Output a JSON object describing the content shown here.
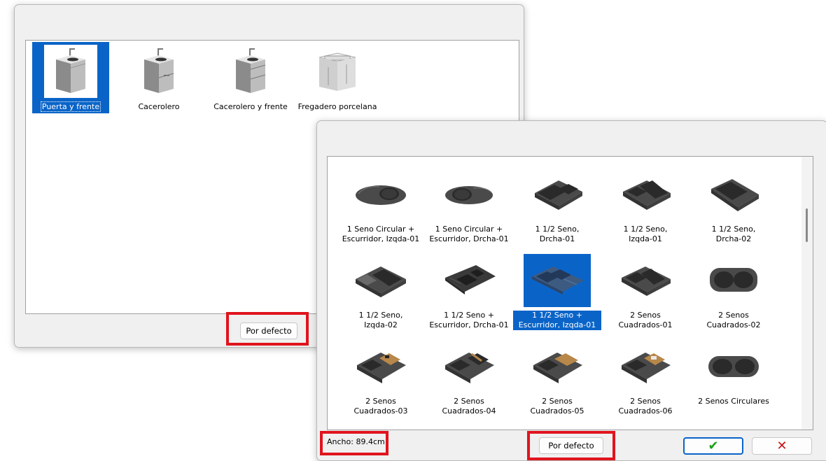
{
  "dialog1": {
    "items": [
      {
        "label": "Puerta y frente",
        "icon": "sink-cabinet-door-icon",
        "selected": true
      },
      {
        "label": "Cacerolero",
        "icon": "sink-cabinet-drawer-icon",
        "selected": false
      },
      {
        "label": "Cacerolero y frente",
        "icon": "sink-cabinet-drawer-front-icon",
        "selected": false
      },
      {
        "label": "Fregadero porcelana",
        "icon": "porcelain-sink-cabinet-icon",
        "selected": false
      }
    ],
    "default_button": "Por defecto"
  },
  "dialog2": {
    "items": [
      {
        "label": "1 Seno Circular +\nEscurridor, Izqda-01",
        "icon": "round-sink-drainer-icon"
      },
      {
        "label": "1 Seno Circular +\nEscurridor, Drcha-01",
        "icon": "round-sink-drainer-icon"
      },
      {
        "label": "1 1/2 Seno,\nDrcha-01",
        "icon": "one-half-sink-icon"
      },
      {
        "label": "1 1/2 Seno,\nIzqda-01",
        "icon": "one-half-sink-icon"
      },
      {
        "label": "1 1/2 Seno,\nDrcha-02",
        "icon": "one-half-sink-icon"
      },
      {
        "label": "1 1/2 Seno,\nIzqda-02",
        "icon": "one-half-sink-icon"
      },
      {
        "label": "1 1/2 Seno +\nEscurridor, Drcha-01",
        "icon": "one-half-sink-drainer-icon"
      },
      {
        "label": "1 1/2 Seno +\nEscurridor, Izqda-01",
        "icon": "one-half-sink-drainer-icon",
        "selected": true
      },
      {
        "label": "2 Senos\nCuadrados-01",
        "icon": "double-square-sink-icon"
      },
      {
        "label": "2 Senos\nCuadrados-02",
        "icon": "double-square-sink-icon"
      },
      {
        "label": "2 Senos\nCuadrados-03",
        "icon": "double-sink-board-icon"
      },
      {
        "label": "2 Senos\nCuadrados-04",
        "icon": "double-sink-board-icon"
      },
      {
        "label": "2 Senos\nCuadrados-05",
        "icon": "double-sink-board-icon"
      },
      {
        "label": "2 Senos\nCuadrados-06",
        "icon": "double-sink-board-icon"
      },
      {
        "label": "2 Senos Circulares",
        "icon": "double-round-sink-icon"
      }
    ],
    "status": "Ancho: 89.4cm",
    "default_button": "Por defecto",
    "ok_symbol": "✔",
    "cancel_symbol": "✕"
  },
  "colors": {
    "selection": "#0a64c8",
    "highlight": "#e0141e",
    "ok": "#1aa01a",
    "cancel": "#c81414"
  }
}
